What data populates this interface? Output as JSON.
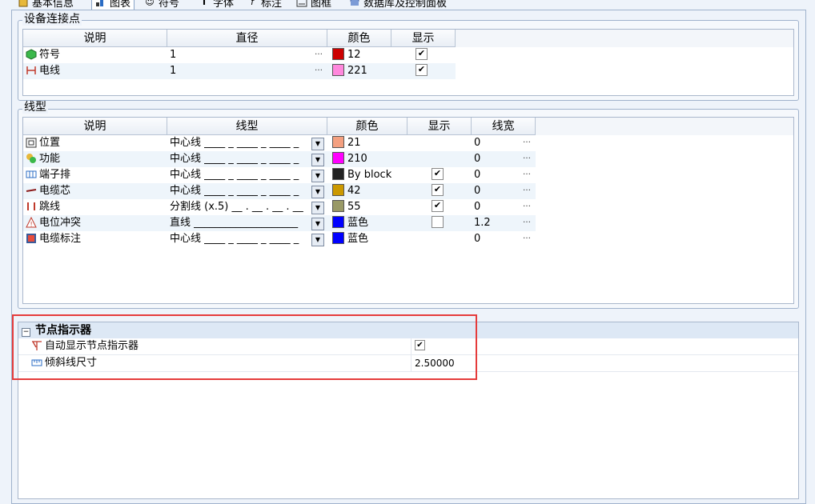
{
  "tabs": [
    {
      "label": "基本信息",
      "icon": "info-icon"
    },
    {
      "label": "图表",
      "icon": "chart-icon",
      "active": true
    },
    {
      "label": "符号",
      "icon": "symbol-icon"
    },
    {
      "label": "字体",
      "icon": "font-icon"
    },
    {
      "label": "标注",
      "icon": "annotation-icon"
    },
    {
      "label": "图框",
      "icon": "frame-icon"
    },
    {
      "label": "数据库及控制面板",
      "icon": "database-icon"
    }
  ],
  "connection": {
    "title": "设备连接点",
    "headers": [
      "说明",
      "直径",
      "颜色",
      "显示"
    ],
    "rows": [
      {
        "name": "符号",
        "icon": "cube-icon",
        "diameter": "1",
        "color_hex": "#cc0000",
        "color": "12",
        "show": true
      },
      {
        "name": "电线",
        "icon": "wire-icon",
        "diameter": "1",
        "color_hex": "#ff88dd",
        "color": "221",
        "show": true
      }
    ]
  },
  "linetype": {
    "title": "线型",
    "headers": [
      "说明",
      "线型",
      "颜色",
      "显示",
      "线宽"
    ],
    "rows": [
      {
        "name": "位置",
        "icon": "location-icon",
        "linetype": "中心线 ____ _ ____ _ ____ _",
        "color_hex": "#f4a080",
        "color": "21",
        "show": null,
        "width": "0"
      },
      {
        "name": "功能",
        "icon": "function-icon",
        "linetype": "中心线 ____ _ ____ _ ____ _",
        "color_hex": "#ff00ff",
        "color": "210",
        "show": null,
        "width": "0"
      },
      {
        "name": "端子排",
        "icon": "terminal-strip-icon",
        "linetype": "中心线 ____ _ ____ _ ____ _",
        "color_hex": "#222222",
        "color": "By block",
        "show": true,
        "width": "0"
      },
      {
        "name": "电缆芯",
        "icon": "cable-core-icon",
        "linetype": "中心线 ____ _ ____ _ ____ _",
        "color_hex": "#cc9900",
        "color": "42",
        "show": true,
        "width": "0"
      },
      {
        "name": "跳线",
        "icon": "jumper-icon",
        "linetype": "分割线 (x.5) __ . __ . __ . __",
        "color_hex": "#999966",
        "color": "55",
        "show": true,
        "width": "0"
      },
      {
        "name": "电位冲突",
        "icon": "potential-conflict-icon",
        "linetype": "直线 ____________________",
        "color_hex": "#0000ff",
        "color": "蓝色",
        "show": false,
        "width": "1.2"
      },
      {
        "name": "电缆标注",
        "icon": "cable-label-icon",
        "linetype": "中心线 ____ _ ____ _ ____ _",
        "color_hex": "#0000ff",
        "color": "蓝色",
        "show": null,
        "width": "0"
      }
    ]
  },
  "node": {
    "section_title": "节点指示器",
    "rows": [
      {
        "label": "自动显示节点指示器",
        "icon": "node-indicator-icon",
        "value": "",
        "checked": true
      },
      {
        "label": "倾斜线尺寸",
        "icon": "ruler-icon",
        "value": "2.50000"
      }
    ]
  },
  "colors": {
    "highlight": "#e53b3b",
    "grid_alt": "#eef5fb",
    "section_bg": "#dde8f5"
  }
}
